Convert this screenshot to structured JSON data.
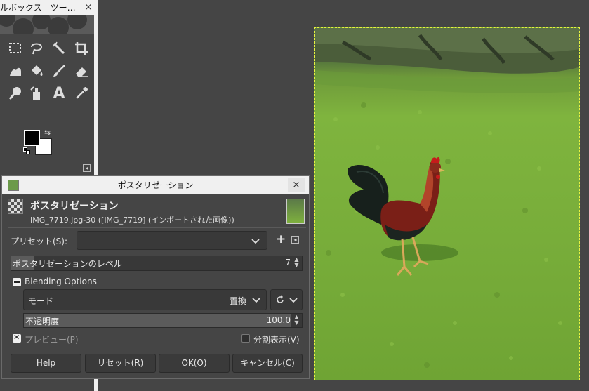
{
  "toolbox": {
    "title": "ルボックス - ツー…",
    "close": "×",
    "dock_toggle": "◂",
    "tools": [
      "rect-select-icon",
      "free-select-icon",
      "fuzzy-select-icon",
      "crop-icon",
      "warp-icon",
      "bucket-fill-icon",
      "paintbrush-icon",
      "eraser-icon",
      "smudge-icon",
      "clone-icon",
      "text-tool-icon",
      "color-picker-icon"
    ],
    "text_tool_glyph": "A",
    "swap_glyph": "⇆"
  },
  "dialog": {
    "window_title": "ポスタリゼーション",
    "close": "×",
    "header_title": "ポスタリゼーション",
    "header_subtitle": "IMG_7719.jpg-30 ([IMG_7719] (インポートされた画像))",
    "preset_label": "プリセット(S):",
    "preset_value": "",
    "preset_add": "+",
    "preset_menu": "◂",
    "levels_label": "ポスタリゼーションのレベル",
    "levels_value": "7",
    "blending_label": "Blending Options",
    "mode_label": "モード",
    "mode_value": "置換",
    "opacity_label": "不透明度",
    "opacity_value": "100.0",
    "preview_label": "プレビュー(P)",
    "split_label": "分割表示(V)",
    "buttons": {
      "help": "Help",
      "reset": "リセット(R)",
      "ok": "OK(O)",
      "cancel": "キャンセル(C)"
    }
  },
  "colors": {
    "foreground": "#000000",
    "background": "#ffffff",
    "selection": "#e9f241"
  }
}
